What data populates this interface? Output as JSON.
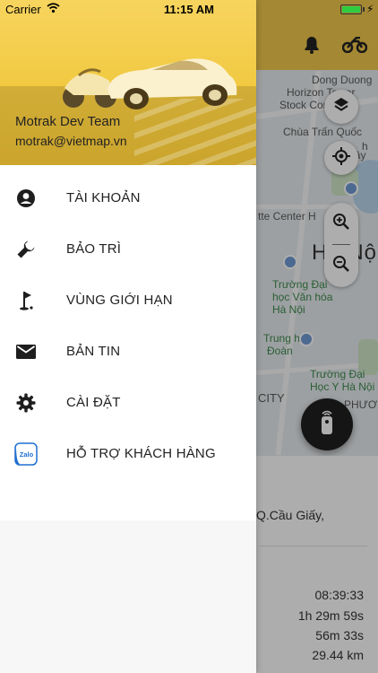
{
  "status_bar": {
    "carrier": "Carrier",
    "time": "11:15 AM",
    "battery_level": 1.0
  },
  "drawer": {
    "user": {
      "name": "Motrak Dev Team",
      "email": "motrak@vietmap.vn"
    },
    "menu": [
      {
        "label": "TÀI KHOẢN",
        "icon": "account-icon"
      },
      {
        "label": "BẢO TRÌ",
        "icon": "wrench-icon"
      },
      {
        "label": "VÙNG GIỚI HẠN",
        "icon": "golf-flag-icon"
      },
      {
        "label": "BẢN TIN",
        "icon": "mail-icon"
      },
      {
        "label": "CÀI ĐẶT",
        "icon": "gear-icon"
      },
      {
        "label": "HỖ TRỢ KHÁCH HÀNG",
        "icon": "zalo-icon",
        "icon_text": "Zalo"
      }
    ]
  },
  "map": {
    "labels": {
      "dong_duong": "Dong Duong",
      "horizon_tower": "Horizon Tower",
      "stock_com": "Stock Com",
      "chua_tran_quoc": "Chùa Trấn Quốc",
      "hinh": "h",
      "ho_tay": "Hồ Tây",
      "center": "tte Center H",
      "ha_noi": "Hà Nội",
      "truong_dai_hoc_van_hoa": "Trường Đại học Văn hóa Hà Nội",
      "trung_hoc": "Trung học",
      "doan": "Đoàn",
      "dai_hoc_y": "Trường Đại Học Y Hà Nội",
      "city": "CITY",
      "phuong": "PHƯƠNG"
    }
  },
  "trip": {
    "address": "Q.Cầu Giấy,",
    "time": "08:39:33",
    "duration": "1h 29m 59s",
    "idle": "56m 33s",
    "distance": "29.44 km"
  },
  "colors": {
    "header_yellow": "#f2c94c",
    "battery_green": "#2ecc40"
  }
}
